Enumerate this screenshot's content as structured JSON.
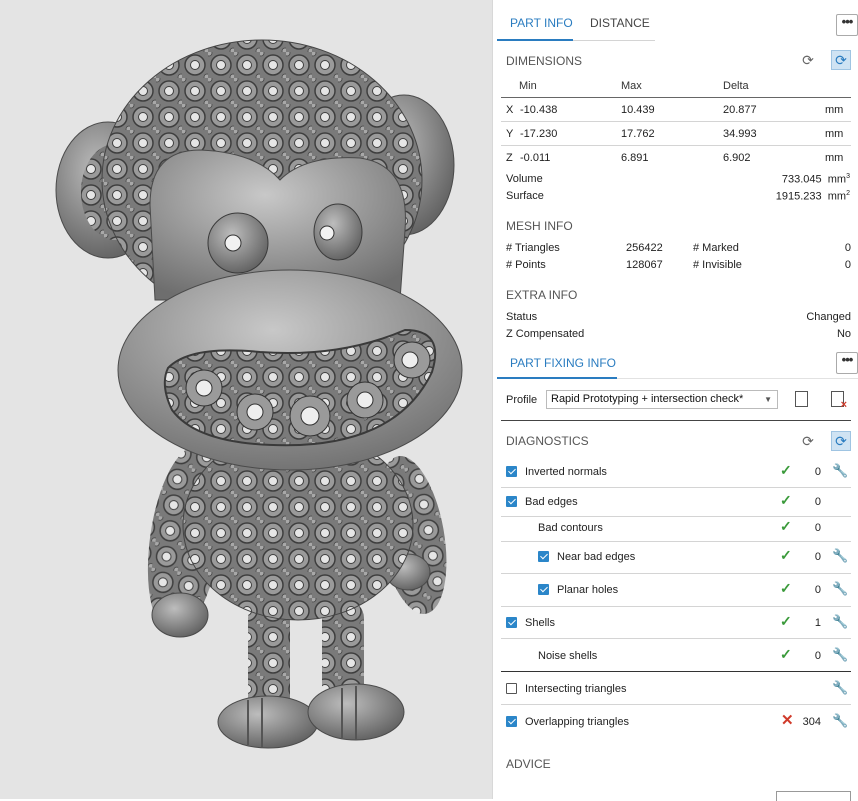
{
  "tabs": [
    {
      "label": "PART INFO",
      "active": true
    },
    {
      "label": "DISTANCE",
      "active": false
    }
  ],
  "menu_label": "•••",
  "dimensions": {
    "title": "DIMENSIONS",
    "headers": [
      "Min",
      "Max",
      "Delta"
    ],
    "rows": [
      {
        "axis": "X",
        "min": "-10.438",
        "max": "10.439",
        "delta": "20.877",
        "unit": "mm"
      },
      {
        "axis": "Y",
        "min": "-17.230",
        "max": "17.762",
        "delta": "34.993",
        "unit": "mm"
      },
      {
        "axis": "Z",
        "min": "-0.011",
        "max": "6.891",
        "delta": "6.902",
        "unit": "mm"
      }
    ],
    "volume_label": "Volume",
    "volume_value": "733.045",
    "volume_unit": "mm",
    "volume_exp": "3",
    "surface_label": "Surface",
    "surface_value": "1915.233",
    "surface_unit": "mm",
    "surface_exp": "2"
  },
  "mesh_info": {
    "title": "MESH INFO",
    "triangles_label": "# Triangles",
    "triangles_value": "256422",
    "points_label": "# Points",
    "points_value": "128067",
    "marked_label": "# Marked",
    "marked_value": "0",
    "invisible_label": "# Invisible",
    "invisible_value": "0"
  },
  "extra_info": {
    "title": "EXTRA INFO",
    "status_label": "Status",
    "status_value": "Changed",
    "zcomp_label": "Z Compensated",
    "zcomp_value": "No"
  },
  "part_fixing": {
    "title": "PART FIXING INFO",
    "profile_label": "Profile",
    "profile_value": "Rapid Prototyping + intersection check*"
  },
  "diagnostics": {
    "title": "DIAGNOSTICS",
    "items": [
      {
        "label": "Inverted normals",
        "value": "0",
        "status": "ok",
        "checkbox": "on",
        "wrench": true
      },
      {
        "label": "Bad edges",
        "value": "0",
        "status": "ok",
        "checkbox": "on",
        "wrench": false
      },
      {
        "label": "Bad contours",
        "value": "0",
        "status": "ok",
        "checkbox": "none",
        "wrench": false
      },
      {
        "label": "Near bad edges",
        "value": "0",
        "status": "ok",
        "checkbox": "on",
        "wrench": true
      },
      {
        "label": "Planar holes",
        "value": "0",
        "status": "ok",
        "checkbox": "on",
        "wrench": true
      },
      {
        "label": "Shells",
        "value": "1",
        "status": "ok",
        "checkbox": "on",
        "wrench": true
      },
      {
        "label": "Noise shells",
        "value": "0",
        "status": "ok",
        "checkbox": "none",
        "wrench": true
      },
      {
        "label": "Intersecting triangles",
        "value": "",
        "status": "none",
        "checkbox": "off",
        "wrench": true
      },
      {
        "label": "Overlapping triangles",
        "value": "304",
        "status": "error",
        "checkbox": "on",
        "wrench": true
      }
    ]
  },
  "advice": {
    "title": "ADVICE"
  },
  "icons": {
    "refresh": "refresh-icon",
    "auto_refresh": "auto-refresh-icon",
    "wrench": "wrench-icon"
  },
  "colors": {
    "accent": "#2a7cc0",
    "ok": "#3a9a3a",
    "error": "#d03a2a"
  }
}
